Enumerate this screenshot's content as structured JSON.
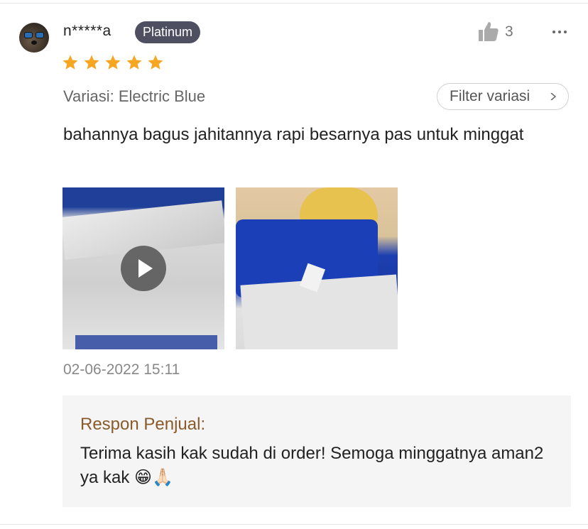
{
  "review": {
    "username": "n*****a",
    "badge": "Platinum",
    "likes": "3",
    "rating": 5,
    "variation": "Variasi: Electric Blue",
    "filter_button": "Filter variasi",
    "text": "bahannya bagus jahitannya rapi besarnya pas untuk minggat",
    "timestamp": "02-06-2022 15:11",
    "media": [
      {
        "type": "video"
      },
      {
        "type": "image"
      }
    ]
  },
  "seller_response": {
    "title": "Respon Penjual:",
    "text": "Terima kasih kak sudah di order! Semoga minggatnya aman2 ya kak 😁🙏🏻"
  },
  "colors": {
    "star": "#f6a623",
    "badge_bg": "#4f4f62",
    "seller_title": "#8a5a2b",
    "seller_bg": "#f5f5f5"
  },
  "icons": {
    "like": "thumbs-up-icon",
    "more": "more-icon",
    "star": "star-icon",
    "chevron": "chevron-right-icon",
    "play": "play-icon"
  }
}
